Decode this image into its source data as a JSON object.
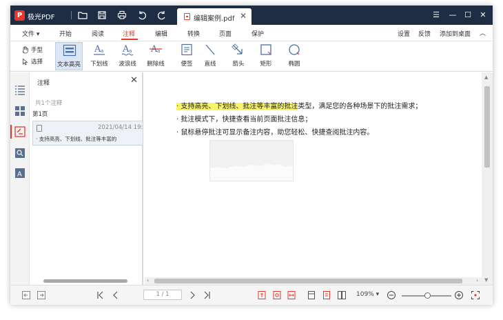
{
  "app": {
    "name": "极光PDF",
    "logo_letter": "P"
  },
  "tab": {
    "label": "编辑案例.pdf",
    "close": "✕"
  },
  "window_controls": {
    "menu": "☰",
    "minimize": "—",
    "maximize": "☐",
    "close": "✕"
  },
  "menubar": {
    "items": [
      {
        "label": "文件 ▾"
      },
      {
        "label": "开始"
      },
      {
        "label": "阅读"
      },
      {
        "label": "注释"
      },
      {
        "label": "编辑"
      },
      {
        "label": "转换"
      },
      {
        "label": "页面"
      },
      {
        "label": "保护"
      }
    ],
    "active_index": 3,
    "right": {
      "settings": "设置",
      "feedback": "反馈",
      "add_desktop": "添加到桌面",
      "collapse": "︿"
    }
  },
  "ribbon": {
    "hand": "手型",
    "select": "选择",
    "tools": [
      {
        "label": "文本高亮",
        "icon": "text-highlight-icon"
      },
      {
        "label": "下划线",
        "icon": "underline-icon"
      },
      {
        "label": "波浪线",
        "icon": "squiggly-icon"
      },
      {
        "label": "删除线",
        "icon": "strikethrough-icon"
      },
      {
        "label": "便签",
        "icon": "sticky-note-icon"
      },
      {
        "label": "直线",
        "icon": "line-icon"
      },
      {
        "label": "箭头",
        "icon": "arrow-icon"
      },
      {
        "label": "矩形",
        "icon": "rectangle-icon"
      },
      {
        "label": "椭圆",
        "icon": "ellipse-icon"
      }
    ]
  },
  "panel": {
    "title": "注释",
    "close": "✕",
    "count": "共1个注释",
    "page": "第1页",
    "item": {
      "date": "2021/04/14 19:",
      "text": "· 支持高亮、下划线、批注等丰富的"
    }
  },
  "document": {
    "line1_highlighted": "· 支持高亮、下划线、批注等丰富的批注",
    "line1_rest": "类型，满足您的各种场景下的批注需求；",
    "line2": "· 批注模式下，快捷查看当前页面批注信息；",
    "line3": "· 鼠标悬停批注可显示备注内容，助您轻松、快捷查阅批注内容。"
  },
  "statusbar": {
    "page_field": "1 / 1",
    "zoom": "109% ▾",
    "zoom_minus": "−",
    "zoom_plus": "+"
  },
  "colors": {
    "accent": "#e8362a",
    "titlebar": "#1f2d44",
    "highlight": "#f7f36a"
  }
}
